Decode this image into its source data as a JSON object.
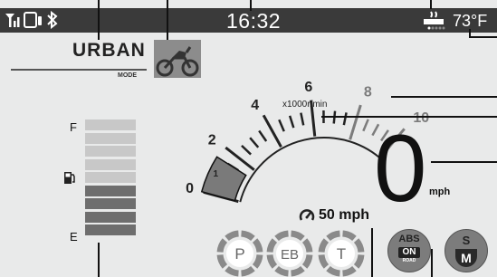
{
  "status_bar": {
    "clock": "16:32",
    "temperature": "73°F",
    "icons": [
      "signal-icon",
      "phone-icon",
      "bluetooth-icon",
      "heated-grip-icon"
    ]
  },
  "mode": {
    "name": "URBAN",
    "caption": "MODE",
    "icon": "motorcycle-icon"
  },
  "tachometer": {
    "unit_label": "x1000r/min",
    "tick_labels": [
      "0",
      "1",
      "2",
      "4",
      "6",
      "8",
      "10"
    ],
    "reading_rpm_x1000": 1.5,
    "max_x1000": 10
  },
  "fuel": {
    "full_label": "F",
    "empty_label": "E",
    "segments_total": 9,
    "segments_filled": 4,
    "icon": "fuel-pump-icon"
  },
  "speed": {
    "value": "0",
    "unit": "mph"
  },
  "cruise": {
    "text": "50 mph",
    "icon": "cruise-control-icon"
  },
  "indicators": [
    {
      "label": "P",
      "name": "parking-brake-indicator"
    },
    {
      "label": "EB",
      "name": "engine-brake-indicator"
    },
    {
      "label": "T",
      "name": "traction-control-indicator"
    }
  ],
  "abs": {
    "label": "ABS",
    "state": "ON",
    "sub": "ROAD"
  },
  "riding_mode_toggle": {
    "top": "S",
    "bottom": "M"
  },
  "colors": {
    "bar_bg": "#3a3a3a",
    "panel_bg": "#e9eaea",
    "fuel_filled": "#6e6e6e",
    "fuel_empty": "#c8c8c8",
    "tach_accent": "#7c7c7c"
  }
}
